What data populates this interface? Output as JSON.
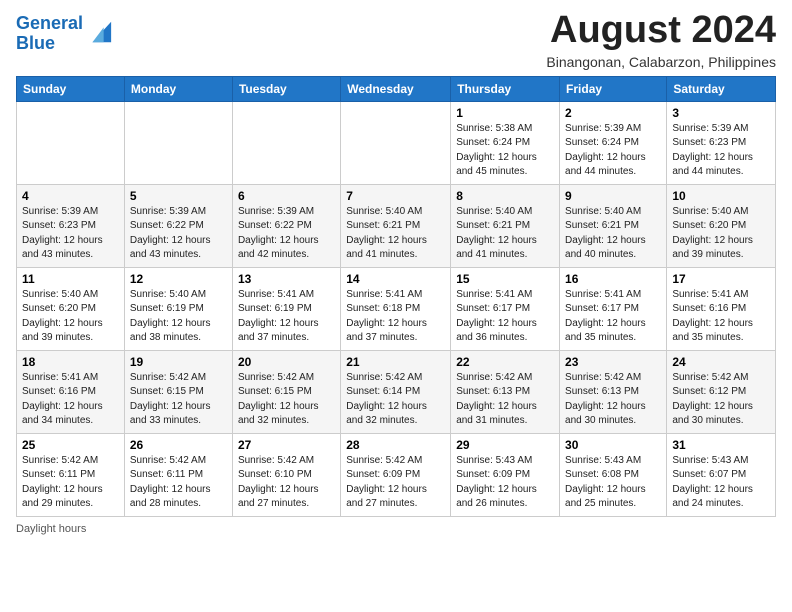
{
  "header": {
    "logo_line1": "General",
    "logo_line2": "Blue",
    "month_year": "August 2024",
    "location": "Binangonan, Calabarzon, Philippines"
  },
  "days_of_week": [
    "Sunday",
    "Monday",
    "Tuesday",
    "Wednesday",
    "Thursday",
    "Friday",
    "Saturday"
  ],
  "weeks": [
    [
      {
        "num": "",
        "info": ""
      },
      {
        "num": "",
        "info": ""
      },
      {
        "num": "",
        "info": ""
      },
      {
        "num": "",
        "info": ""
      },
      {
        "num": "1",
        "info": "Sunrise: 5:38 AM\nSunset: 6:24 PM\nDaylight: 12 hours\nand 45 minutes."
      },
      {
        "num": "2",
        "info": "Sunrise: 5:39 AM\nSunset: 6:24 PM\nDaylight: 12 hours\nand 44 minutes."
      },
      {
        "num": "3",
        "info": "Sunrise: 5:39 AM\nSunset: 6:23 PM\nDaylight: 12 hours\nand 44 minutes."
      }
    ],
    [
      {
        "num": "4",
        "info": "Sunrise: 5:39 AM\nSunset: 6:23 PM\nDaylight: 12 hours\nand 43 minutes."
      },
      {
        "num": "5",
        "info": "Sunrise: 5:39 AM\nSunset: 6:22 PM\nDaylight: 12 hours\nand 43 minutes."
      },
      {
        "num": "6",
        "info": "Sunrise: 5:39 AM\nSunset: 6:22 PM\nDaylight: 12 hours\nand 42 minutes."
      },
      {
        "num": "7",
        "info": "Sunrise: 5:40 AM\nSunset: 6:21 PM\nDaylight: 12 hours\nand 41 minutes."
      },
      {
        "num": "8",
        "info": "Sunrise: 5:40 AM\nSunset: 6:21 PM\nDaylight: 12 hours\nand 41 minutes."
      },
      {
        "num": "9",
        "info": "Sunrise: 5:40 AM\nSunset: 6:21 PM\nDaylight: 12 hours\nand 40 minutes."
      },
      {
        "num": "10",
        "info": "Sunrise: 5:40 AM\nSunset: 6:20 PM\nDaylight: 12 hours\nand 39 minutes."
      }
    ],
    [
      {
        "num": "11",
        "info": "Sunrise: 5:40 AM\nSunset: 6:20 PM\nDaylight: 12 hours\nand 39 minutes."
      },
      {
        "num": "12",
        "info": "Sunrise: 5:40 AM\nSunset: 6:19 PM\nDaylight: 12 hours\nand 38 minutes."
      },
      {
        "num": "13",
        "info": "Sunrise: 5:41 AM\nSunset: 6:19 PM\nDaylight: 12 hours\nand 37 minutes."
      },
      {
        "num": "14",
        "info": "Sunrise: 5:41 AM\nSunset: 6:18 PM\nDaylight: 12 hours\nand 37 minutes."
      },
      {
        "num": "15",
        "info": "Sunrise: 5:41 AM\nSunset: 6:17 PM\nDaylight: 12 hours\nand 36 minutes."
      },
      {
        "num": "16",
        "info": "Sunrise: 5:41 AM\nSunset: 6:17 PM\nDaylight: 12 hours\nand 35 minutes."
      },
      {
        "num": "17",
        "info": "Sunrise: 5:41 AM\nSunset: 6:16 PM\nDaylight: 12 hours\nand 35 minutes."
      }
    ],
    [
      {
        "num": "18",
        "info": "Sunrise: 5:41 AM\nSunset: 6:16 PM\nDaylight: 12 hours\nand 34 minutes."
      },
      {
        "num": "19",
        "info": "Sunrise: 5:42 AM\nSunset: 6:15 PM\nDaylight: 12 hours\nand 33 minutes."
      },
      {
        "num": "20",
        "info": "Sunrise: 5:42 AM\nSunset: 6:15 PM\nDaylight: 12 hours\nand 32 minutes."
      },
      {
        "num": "21",
        "info": "Sunrise: 5:42 AM\nSunset: 6:14 PM\nDaylight: 12 hours\nand 32 minutes."
      },
      {
        "num": "22",
        "info": "Sunrise: 5:42 AM\nSunset: 6:13 PM\nDaylight: 12 hours\nand 31 minutes."
      },
      {
        "num": "23",
        "info": "Sunrise: 5:42 AM\nSunset: 6:13 PM\nDaylight: 12 hours\nand 30 minutes."
      },
      {
        "num": "24",
        "info": "Sunrise: 5:42 AM\nSunset: 6:12 PM\nDaylight: 12 hours\nand 30 minutes."
      }
    ],
    [
      {
        "num": "25",
        "info": "Sunrise: 5:42 AM\nSunset: 6:11 PM\nDaylight: 12 hours\nand 29 minutes."
      },
      {
        "num": "26",
        "info": "Sunrise: 5:42 AM\nSunset: 6:11 PM\nDaylight: 12 hours\nand 28 minutes."
      },
      {
        "num": "27",
        "info": "Sunrise: 5:42 AM\nSunset: 6:10 PM\nDaylight: 12 hours\nand 27 minutes."
      },
      {
        "num": "28",
        "info": "Sunrise: 5:42 AM\nSunset: 6:09 PM\nDaylight: 12 hours\nand 27 minutes."
      },
      {
        "num": "29",
        "info": "Sunrise: 5:43 AM\nSunset: 6:09 PM\nDaylight: 12 hours\nand 26 minutes."
      },
      {
        "num": "30",
        "info": "Sunrise: 5:43 AM\nSunset: 6:08 PM\nDaylight: 12 hours\nand 25 minutes."
      },
      {
        "num": "31",
        "info": "Sunrise: 5:43 AM\nSunset: 6:07 PM\nDaylight: 12 hours\nand 24 minutes."
      }
    ]
  ],
  "footer": {
    "daylight_label": "Daylight hours"
  }
}
